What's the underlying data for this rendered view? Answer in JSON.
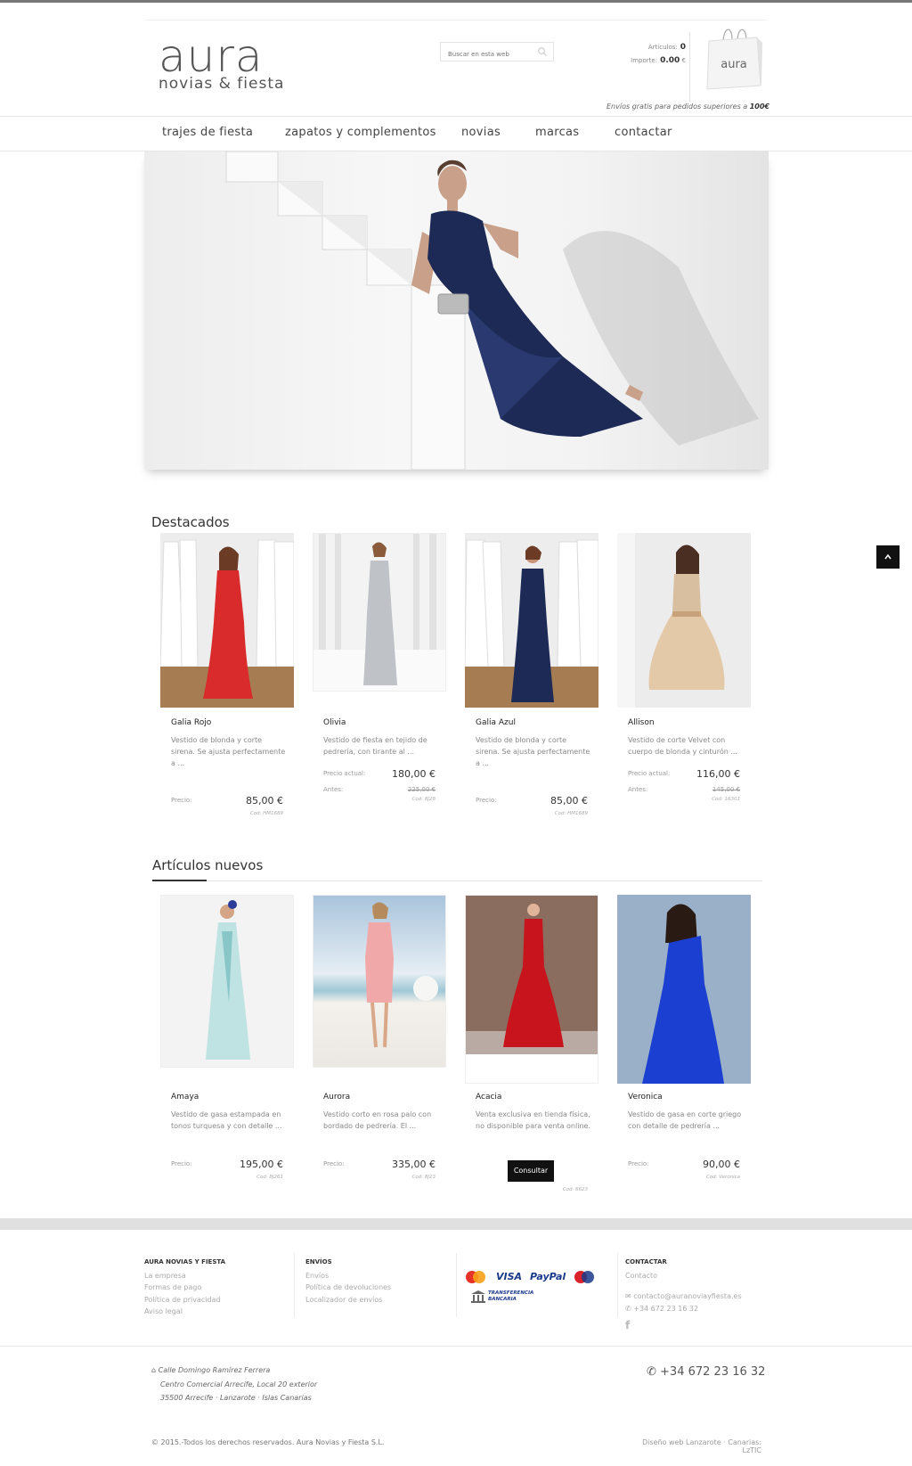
{
  "header": {
    "logo_main": "aura",
    "logo_sub": "novias & fiesta",
    "search_placeholder": "Buscar en esta web",
    "cart": {
      "items_label": "Artículos:",
      "items_value": "0",
      "total_label": "Importe:",
      "total_value": "0.00",
      "currency": "€"
    },
    "bag_text": "aura",
    "shipping_text": "Envíos gratis para pedidos superiores a",
    "shipping_amount": "100€"
  },
  "nav": [
    "trajes de fiesta",
    "zapatos y complementos",
    "novias",
    "marcas",
    "contactar"
  ],
  "featured": {
    "title": "Destacados",
    "products": [
      {
        "name": "Galia Rojo",
        "desc": "Vestido de blonda y corte sirena. Se ajusta perfectamente a ...",
        "price_label": "Precio:",
        "price": "85,00 €",
        "code": "Cod: HM1689"
      },
      {
        "name": "Olivia",
        "desc": "Vestido de fiesta en tejido de pedrería, con tirante al ...",
        "price_label": "Precio actual:",
        "price": "180,00 €",
        "old_label": "Antes:",
        "old_price": "225,00 €",
        "code": "Cod: 8J28"
      },
      {
        "name": "Galia Azul",
        "desc": "Vestido de blonda y corte sirena. Se ajusta perfectamente a ...",
        "price_label": "Precio:",
        "price": "85,00 €",
        "code": "Cod: HM1689"
      },
      {
        "name": "Allison",
        "desc": "Vestido de corte Velvet con cuerpo de blonda y cinturón ...",
        "price_label": "Precio actual:",
        "price": "116,00 €",
        "old_label": "Antes:",
        "old_price": "145,00 €",
        "code": "Cod: 16301"
      }
    ]
  },
  "new_items": {
    "title": "Artículos nuevos",
    "products": [
      {
        "name": "Amaya",
        "desc": "Vestido de gasa estampada en tonos turquesa y con detalle ...",
        "price_label": "Precio:",
        "price": "195,00 €",
        "code": "Cod: 8J261"
      },
      {
        "name": "Aurora",
        "desc": "Vestido corto en rosa palo con bordado de pedrería. El ...",
        "price_label": "Precio:",
        "price": "335,00 €",
        "code": "Cod: 8J23"
      },
      {
        "name": "Acacia",
        "desc": "Venta exclusiva en tienda física, no disponible para venta online.",
        "button": "Consultar",
        "code": "Cod: 6623"
      },
      {
        "name": "Veronica",
        "desc": "Vestido de gasa en corte griego con detalle de pedrería ...",
        "price_label": "Precio:",
        "price": "90,00 €",
        "code": "Cod: Veronica"
      }
    ]
  },
  "footer": {
    "col1": {
      "title": "AURA NOVIAS Y FIESTA",
      "links": [
        "La empresa",
        "Formas de pago",
        "Política de privacidad",
        "Aviso legal"
      ]
    },
    "col2": {
      "title": "ENVÍOS",
      "links": [
        "Envíos",
        "Política de devoluciones",
        "Localizador de envíos"
      ]
    },
    "payments": {
      "visa": "VISA",
      "paypal": "PayPal",
      "transfer": "TRANSFERENCIA BANCARIA"
    },
    "col4": {
      "title": "CONTACTAR",
      "link": "Contacto",
      "email": "contacto@auranoviayfiesta.es",
      "phone": "+34 672 23 16 32"
    },
    "address": [
      "Calle Domingo Ramírez Ferrera",
      "Centro Comercial Arrecife, Local 20 exterior",
      "35500 Arrecife · Lanzarote · Islas Canarias"
    ],
    "phone_big": "+34 672 23 16 32",
    "copyright": "© 2015.-Todos los derechos reservados. Aura Novias y Fiesta S.L.",
    "credit": "Diseño web Lanzarote · Canarias: LzTIC"
  }
}
